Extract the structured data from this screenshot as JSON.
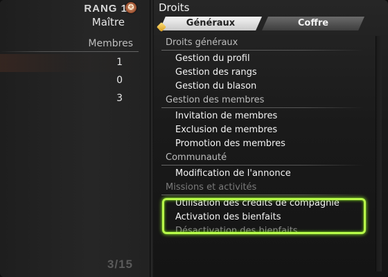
{
  "left_panel": {
    "rank_label": "RANG 1",
    "rank_icon": "✪",
    "rank_name": "Maître",
    "members_header": "Membres",
    "member_counts": [
      "1",
      "0",
      "3"
    ],
    "page_count": "3/15"
  },
  "right_panel": {
    "title": "Droits",
    "tabs": [
      {
        "label": "Généraux",
        "active": true
      },
      {
        "label": "Coffre",
        "active": false
      }
    ],
    "sections": [
      {
        "header": "Droits généraux",
        "items": [
          "Gestion du profil",
          "Gestion des rangs",
          "Gestion du blason"
        ]
      },
      {
        "header": "Gestion des membres",
        "items": [
          "Invitation de membres",
          "Exclusion de membres",
          "Promotion des membres"
        ]
      },
      {
        "header": "Communauté",
        "items": [
          "Modification de l'annonce"
        ]
      },
      {
        "header": "Missions et activités",
        "items": [
          "Utilisation des crédits de compagnie",
          "Activation des bienfaits",
          "Désactivation des bienfaits"
        ]
      }
    ]
  },
  "colors": {
    "highlight": "#b9ff4a",
    "text": "#f5f5f5"
  },
  "icons": [
    "rank-emblem-icon",
    "active-tab-marker-icon"
  ]
}
